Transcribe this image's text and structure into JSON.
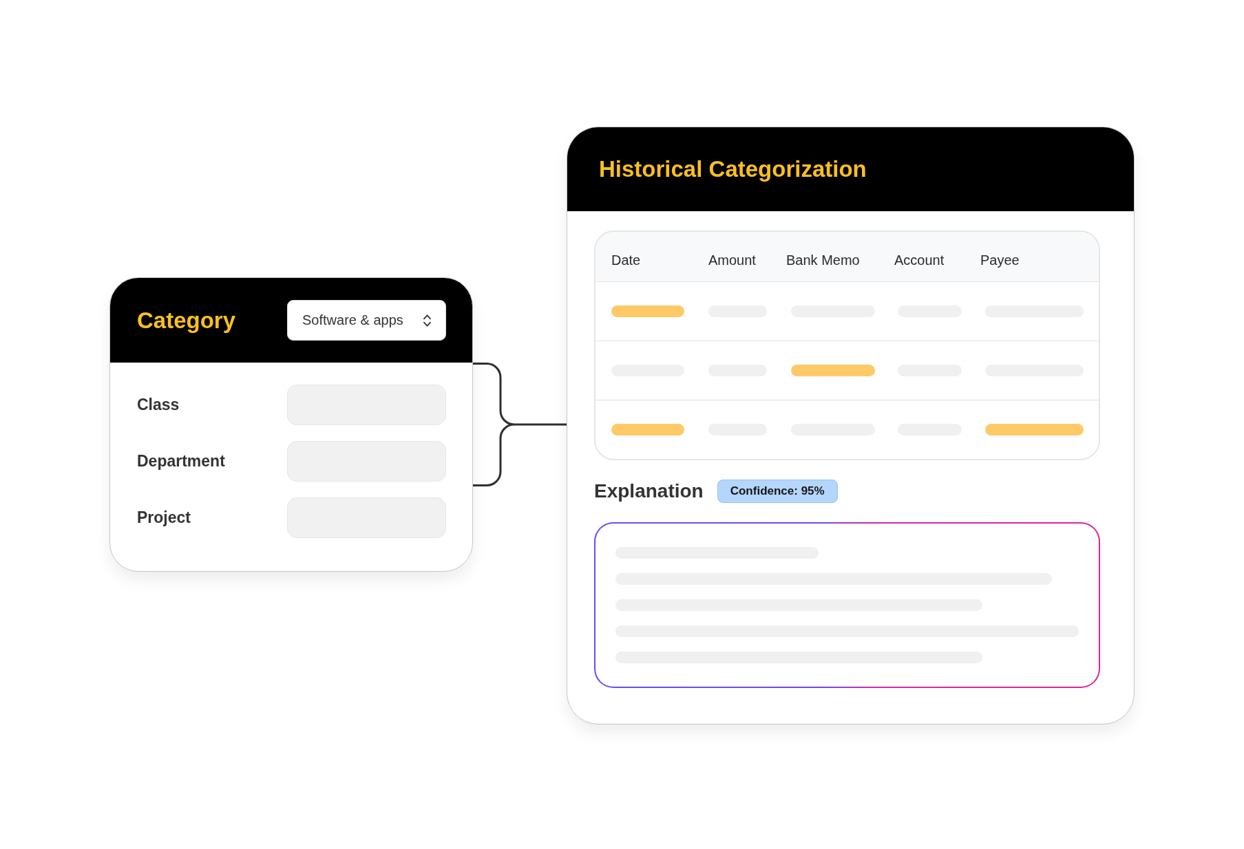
{
  "category_card": {
    "title": "Category",
    "dropdown": {
      "value": "Software & apps"
    },
    "fields": [
      {
        "label": "Class"
      },
      {
        "label": "Department"
      },
      {
        "label": "Project"
      }
    ]
  },
  "history_card": {
    "title": "Historical Categorization",
    "table": {
      "columns": [
        "Date",
        "Amount",
        "Bank Memo",
        "Account",
        "Payee"
      ],
      "rows": [
        {
          "cells": [
            {
              "highlighted": true
            },
            {
              "highlighted": false
            },
            {
              "highlighted": false
            },
            {
              "highlighted": false
            },
            {
              "highlighted": false
            }
          ]
        },
        {
          "cells": [
            {
              "highlighted": false
            },
            {
              "highlighted": false
            },
            {
              "highlighted": true
            },
            {
              "highlighted": false
            },
            {
              "highlighted": false
            }
          ]
        },
        {
          "cells": [
            {
              "highlighted": true
            },
            {
              "highlighted": false
            },
            {
              "highlighted": false
            },
            {
              "highlighted": false
            },
            {
              "highlighted": true
            }
          ]
        }
      ]
    },
    "explanation": {
      "title": "Explanation",
      "badge": "Confidence: 95%"
    }
  }
}
